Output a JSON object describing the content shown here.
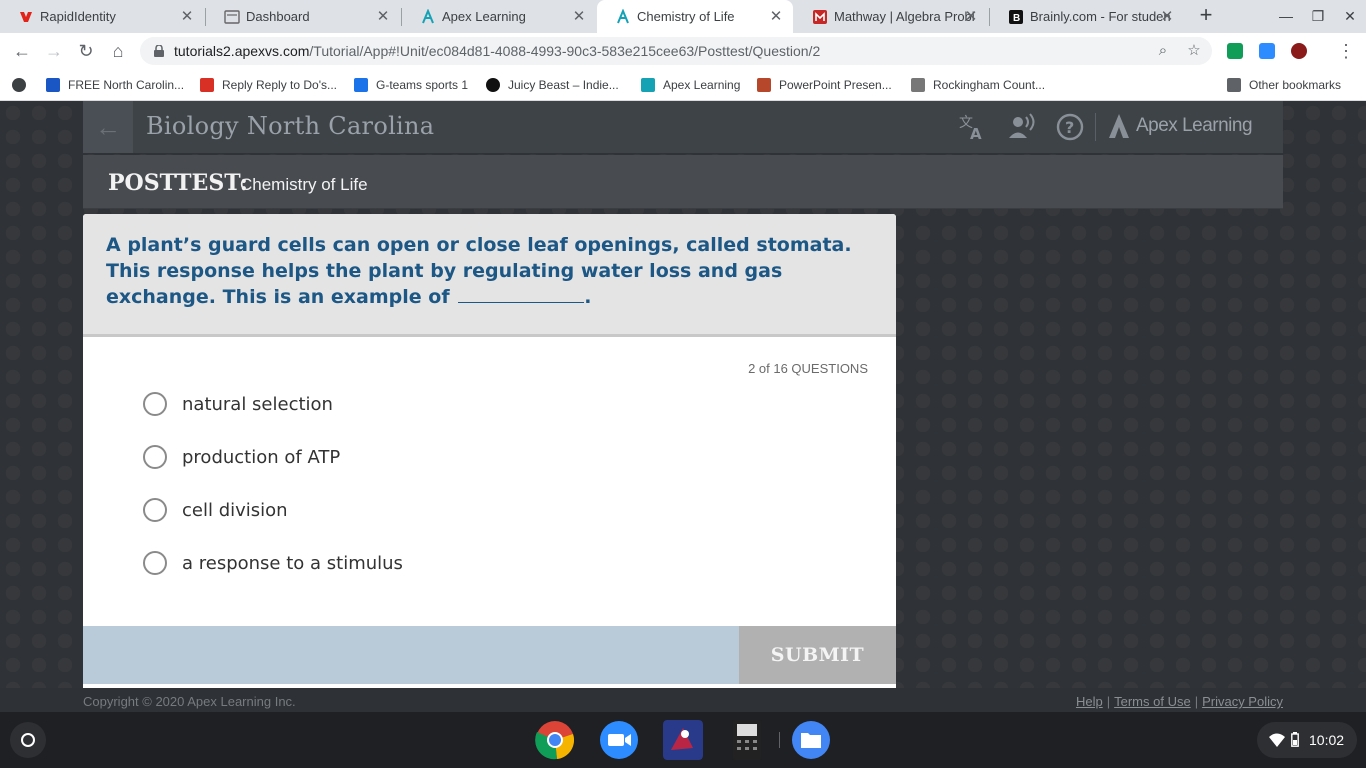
{
  "browser": {
    "tabs": [
      {
        "title": "RapidIdentity",
        "icon": "rapididentity-icon",
        "active": false
      },
      {
        "title": "Dashboard",
        "icon": "dashboard-icon",
        "active": false
      },
      {
        "title": "Apex Learning",
        "icon": "apex-icon",
        "active": false
      },
      {
        "title": "Chemistry of Life",
        "icon": "apex-icon",
        "active": true
      },
      {
        "title": "Mathway | Algebra Problem Solver",
        "icon": "mathway-icon",
        "active": false
      },
      {
        "title": "Brainly.com - For students. By students.",
        "icon": "brainly-icon",
        "active": false
      }
    ],
    "url_host": "tutorials2.apexvs.com",
    "url_path": "/Tutorial/App#!Unit/ec084d81-4088-4993-90c3-583e215cee63/Posttest/Question/2",
    "bookmarks": [
      {
        "label": "FREE North Carolin...",
        "color": "#1a56c4"
      },
      {
        "label": "Reply Reply to Do's...",
        "color": "#d93025"
      },
      {
        "label": "G-teams sports 1",
        "color": "#1a73e8"
      },
      {
        "label": "Juicy Beast – Indie...",
        "color": "#111111"
      },
      {
        "label": "Apex Learning",
        "color": "#15a2b5"
      },
      {
        "label": "PowerPoint Presen...",
        "color": "#b7472a"
      },
      {
        "label": "Rockingham Count...",
        "color": "#555555"
      }
    ],
    "other_bookmarks": "Other bookmarks"
  },
  "header": {
    "course_title": "Biology North Carolina",
    "brand": "Apex Learning"
  },
  "test": {
    "label": "POSTTEST:",
    "subtitle": "Chemistry of Life"
  },
  "question": {
    "text": "A plant’s guard cells can open or close leaf openings, called stomata. This response helps the plant by regulating water loss and gas exchange. This is an example of",
    "text_end": ".",
    "counter": "2 of 16 QUESTIONS",
    "options": [
      "natural selection",
      "production of ATP",
      "cell division",
      "a response to a stimulus"
    ],
    "submit_label": "SUBMIT"
  },
  "footer": {
    "copyright": "Copyright © 2020 Apex Learning Inc.",
    "links": [
      "Help",
      "Terms of Use",
      "Privacy Policy"
    ]
  },
  "shelf": {
    "time": "10:02"
  },
  "colors": {
    "question_text": "#1c5785",
    "submit_bg": "#b1b1b1",
    "submit_row": "#b9cad8"
  }
}
